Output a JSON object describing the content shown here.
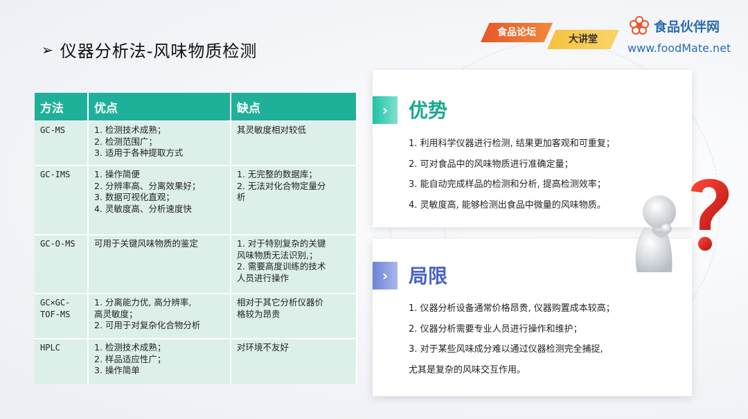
{
  "slide": {
    "title_arrow": "➢",
    "title": "仪器分析法-风味物质检测"
  },
  "brand": {
    "badge_forum": "食品论坛",
    "badge_lecture": "大讲堂",
    "name": "食品伙伴网",
    "url": "www.foodMate.net",
    "logo_icon": "foodmate-flower-logo-icon",
    "accent": "#2b6cb0"
  },
  "table": {
    "headers": [
      "方法",
      "优点",
      "缺点"
    ],
    "header_color": "#1fb09a",
    "row_color": "#dcefe9",
    "rows": [
      {
        "method": [
          "GC-MS"
        ],
        "pros": [
          "1. 检测技术成熟；",
          "2. 检测范围广；",
          "3. 适用于各种提取方式"
        ],
        "cons": [
          "其灵敏度相对较低"
        ]
      },
      {
        "method": [
          "GC-IMS"
        ],
        "pros": [
          "1. 操作简便",
          "2. 分辨率高、分离效果好；",
          "3. 数据可视化直观；",
          "4. 灵敏度高、分析速度快"
        ],
        "cons": [
          "1. 无完整的数据库；",
          "2. 无法对化合物定量分",
          "析"
        ]
      },
      {
        "method": [
          "GC-O-MS"
        ],
        "pros": [
          "可用于关键风味物质的鉴定"
        ],
        "cons": [
          "1. 对于特别复杂的关键",
          "风味物质无法识别,；",
          "2. 需要高度训练的技术",
          "人员进行操作"
        ]
      },
      {
        "method": [
          "GC×GC-",
          "TOF-MS"
        ],
        "pros": [
          "1. 分离能力优, 高分辨率,",
          "高灵敏度；",
          "2. 可用于对复杂化合物分析"
        ],
        "cons": [
          "相对于其它分析仪器价",
          "格较为昂贵"
        ]
      },
      {
        "method": [
          "HPLC"
        ],
        "pros": [
          "1. 检测技术成熟；",
          "2. 样品适应性广；",
          "3. 操作简单"
        ],
        "cons": [
          "对环境不友好"
        ]
      }
    ]
  },
  "advantages": {
    "chevron": "›",
    "heading": "优势",
    "color": "#16a88f",
    "items": [
      "1. 利用科学仪器进行检测, 结果更加客观和可重复；",
      "2. 可对食品中的风味物质进行准确定量；",
      "3. 能自动完成样品的检测和分析, 提高检测效率；",
      "4. 灵敏度高, 能够检测出食品中微量的风味物质。"
    ]
  },
  "limitations": {
    "chevron": "›",
    "heading": "局限",
    "color": "#4a62c4",
    "items": [
      "1. 仪器分析设备通常价格昂贵, 仪器购置成本较高；",
      "2. 仪器分析需要专业人员进行操作和维护；",
      "3. 对于某些风味成分难以通过仪器检测完全捕捉,"
    ],
    "item3_continuation": "尤其是复杂的风味交互作用。"
  },
  "figure": {
    "icon": "thinking-person-question-mark-icon",
    "question_color": "#e02020"
  }
}
